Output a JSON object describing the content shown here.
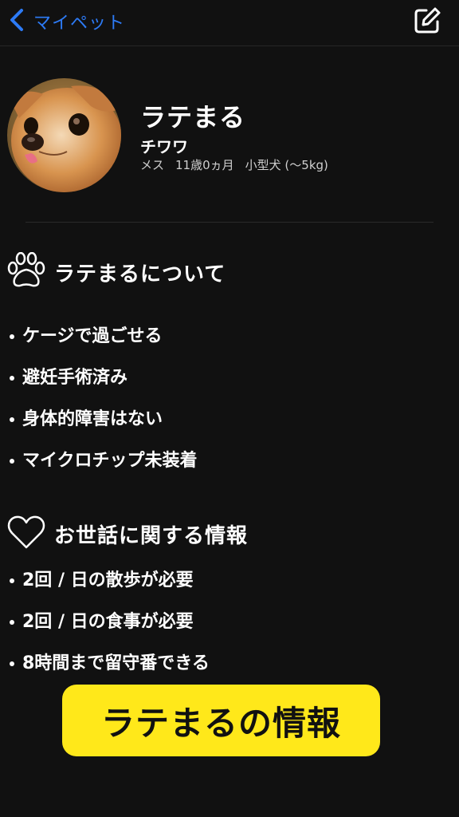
{
  "colors": {
    "background": "#111111",
    "accent_blue": "#2d7bf6",
    "banner_yellow": "#ffe81a",
    "text_primary": "#ffffff",
    "text_secondary": "#cfcfcf"
  },
  "nav": {
    "back_label": "マイペット",
    "back_icon": "chevron-left-icon",
    "edit_icon": "edit-square-icon"
  },
  "profile": {
    "avatar_icon": "dog-photo",
    "name": "ラテまる",
    "breed": "チワワ",
    "sex": "メス",
    "age": "11歳0ヵ月",
    "size": "小型犬 (〜5kg)"
  },
  "about": {
    "icon": "paw-icon",
    "title": "ラテまるについて",
    "items": [
      "ケージで過ごせる",
      "避妊手術済み",
      "身体的障害はない",
      "マイクロチップ未装着"
    ]
  },
  "care": {
    "icon": "heart-icon",
    "title": "お世話に関する情報",
    "items": [
      "2回 / 日の散歩が必要",
      "2回 / 日の食事が必要",
      "8時間まで留守番できる"
    ]
  },
  "banner": {
    "text": "ラテまるの情報"
  }
}
